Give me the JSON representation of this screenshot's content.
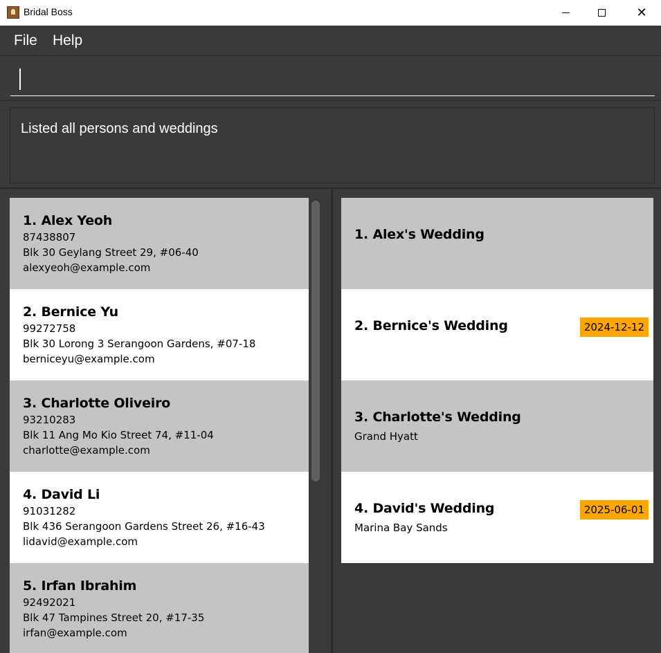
{
  "window": {
    "title": "Bridal Boss"
  },
  "menu": {
    "file": "File",
    "help": "Help"
  },
  "command": {
    "value": "",
    "placeholder": ""
  },
  "result": {
    "message": "Listed all persons and weddings"
  },
  "persons": [
    {
      "name": "1.  Alex Yeoh",
      "phone": "87438807",
      "address": "Blk 30 Geylang Street 29, #06-40",
      "email": "alexyeoh@example.com"
    },
    {
      "name": "2.  Bernice Yu",
      "phone": "99272758",
      "address": "Blk 30 Lorong 3 Serangoon Gardens, #07-18",
      "email": "berniceyu@example.com"
    },
    {
      "name": "3.  Charlotte Oliveiro",
      "phone": "93210283",
      "address": "Blk 11 Ang Mo Kio Street 74, #11-04",
      "email": "charlotte@example.com"
    },
    {
      "name": "4.  David Li",
      "phone": "91031282",
      "address": "Blk 436 Serangoon Gardens Street 26, #16-43",
      "email": "lidavid@example.com"
    },
    {
      "name": "5.  Irfan Ibrahim",
      "phone": "92492021",
      "address": "Blk 47 Tampines Street 20, #17-35",
      "email": "irfan@example.com"
    }
  ],
  "weddings": [
    {
      "name": "1.  Alex's Wedding",
      "venue": "",
      "date": ""
    },
    {
      "name": "2.  Bernice's Wedding",
      "venue": "",
      "date": "2024-12-12"
    },
    {
      "name": "3.  Charlotte's Wedding",
      "venue": "Grand Hyatt",
      "date": ""
    },
    {
      "name": "4.  David's Wedding",
      "venue": "Marina Bay Sands",
      "date": "2025-06-01"
    }
  ],
  "colors": {
    "background": "#3a3a3a",
    "card_grey": "#c4c4c4",
    "card_white": "#ffffff",
    "date_tag": "#ffa500"
  }
}
